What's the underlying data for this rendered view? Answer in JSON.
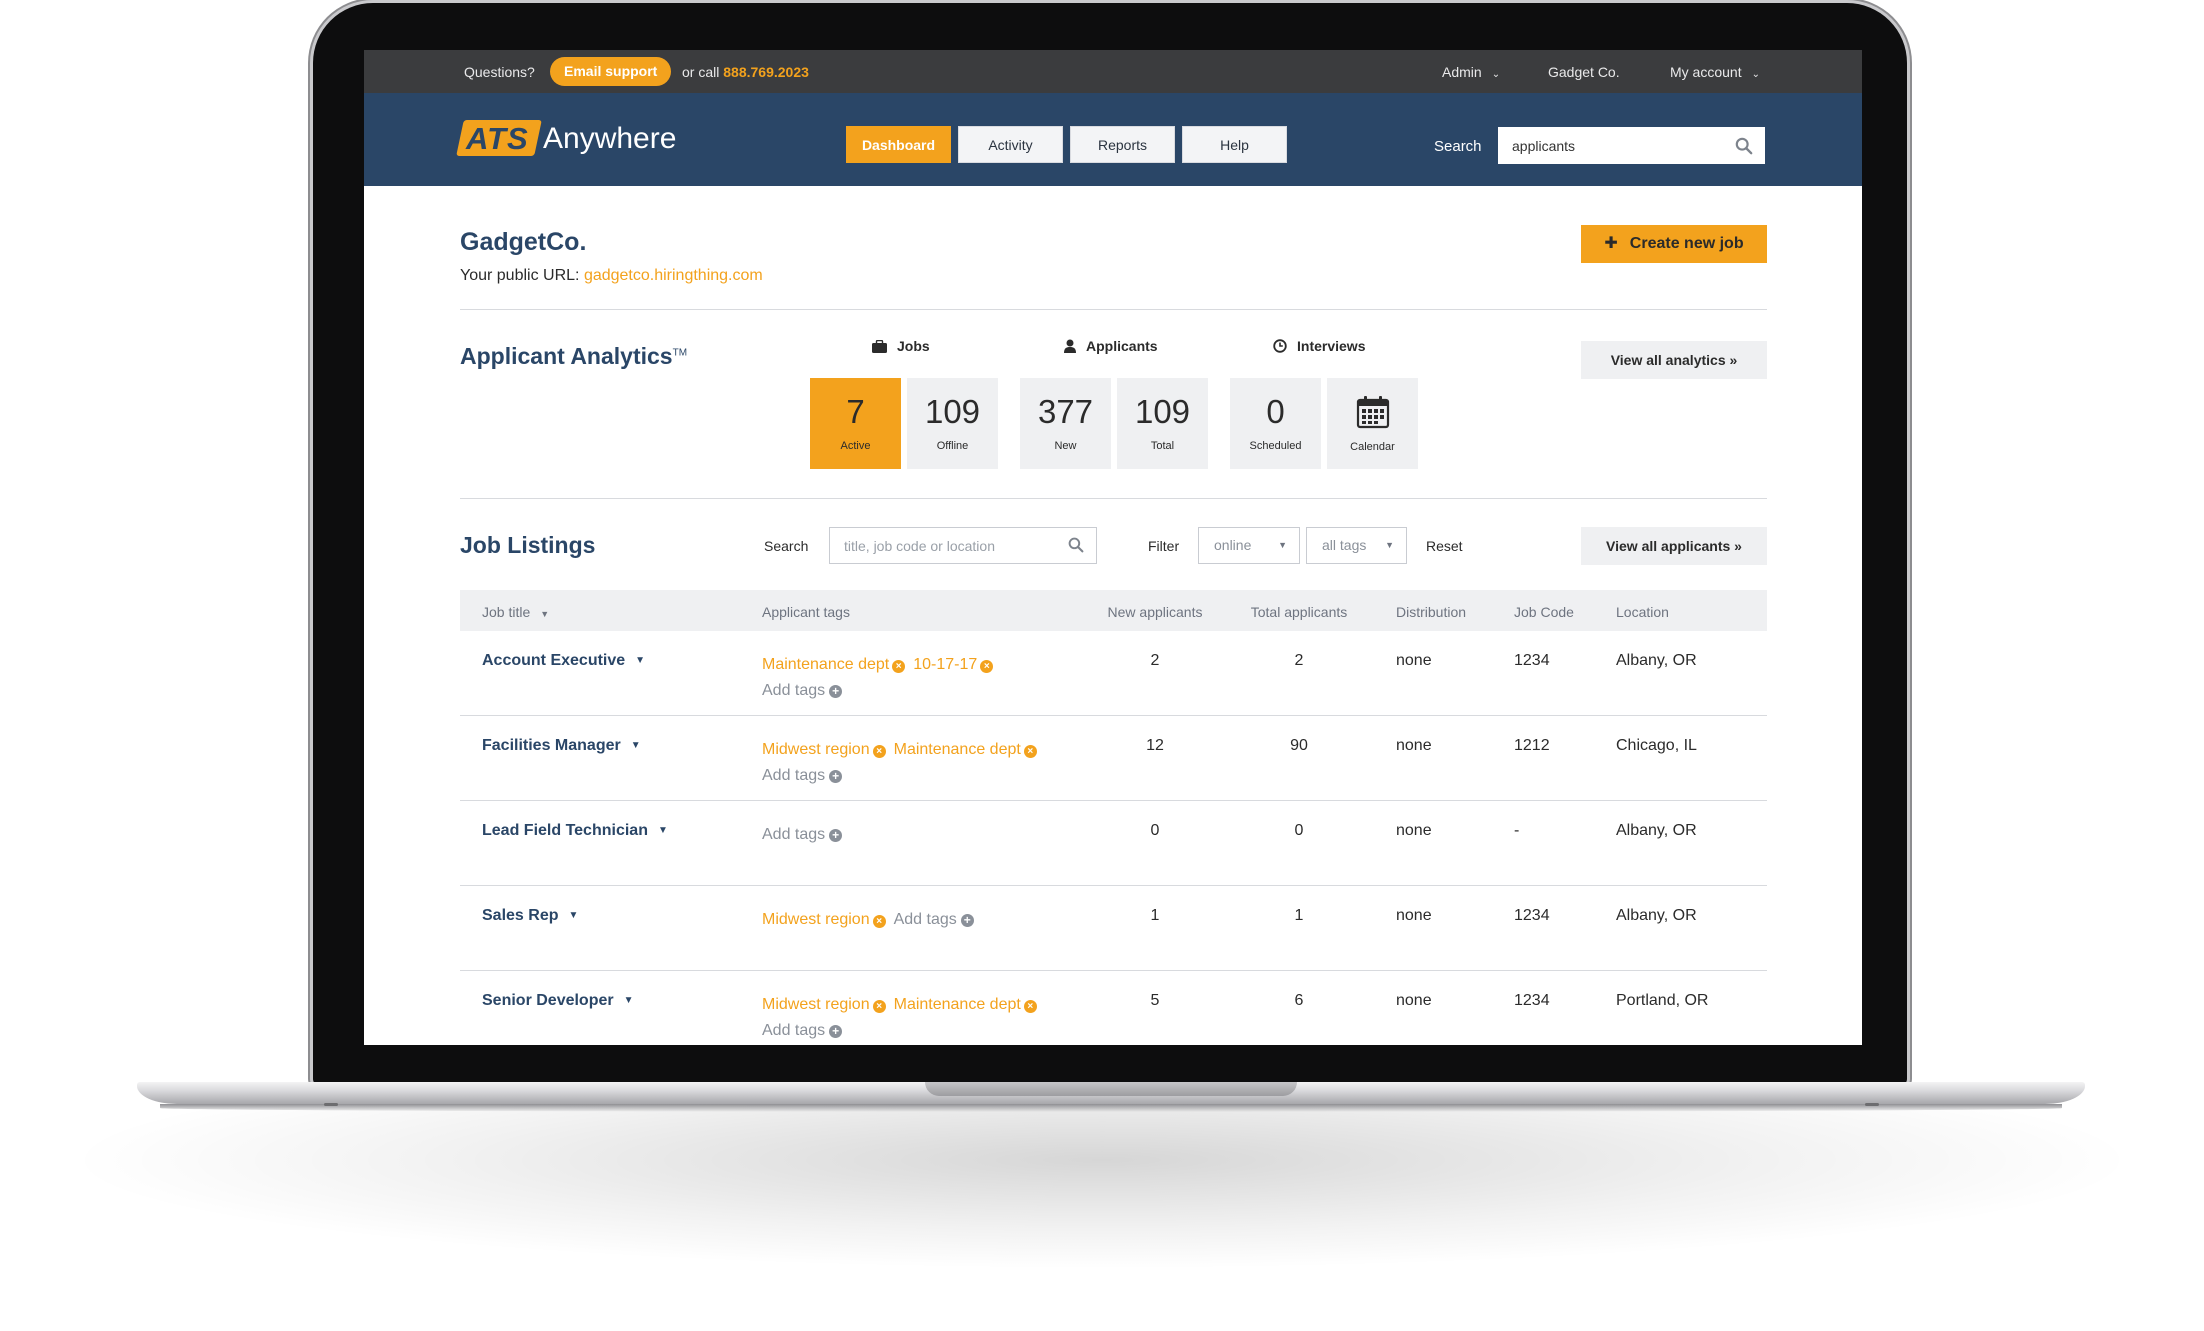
{
  "topbar": {
    "questions": "Questions?",
    "email_support": "Email support",
    "or_call": "or call",
    "phone": "888.769.2023",
    "admin": "Admin",
    "company": "Gadget Co.",
    "my_account": "My account"
  },
  "nav": {
    "logo_ats": "ATS",
    "logo_anywhere": "Anywhere",
    "items": [
      "Dashboard",
      "Activity",
      "Reports",
      "Help"
    ],
    "active": "Dashboard",
    "search_label": "Search",
    "search_value": "applicants"
  },
  "header": {
    "company_name": "GadgetCo.",
    "public_url_label": "Your public URL:",
    "public_url": "gadgetco.hiringthing.com",
    "create_job": "Create new job"
  },
  "analytics": {
    "title": "Applicant Analytics",
    "trademark": "TM",
    "view_all": "View all analytics",
    "groups": {
      "jobs": "Jobs",
      "applicants": "Applicants",
      "interviews": "Interviews"
    },
    "stats": [
      {
        "value": "7",
        "label": "Active"
      },
      {
        "value": "109",
        "label": "Offline"
      },
      {
        "value": "377",
        "label": "New"
      },
      {
        "value": "109",
        "label": "Total"
      },
      {
        "value": "0",
        "label": "Scheduled"
      },
      {
        "value": "",
        "label": "Calendar"
      }
    ]
  },
  "listings": {
    "title": "Job Listings",
    "search_label": "Search",
    "search_placeholder": "title, job code or location",
    "filter_label": "Filter",
    "filter_status": "online",
    "filter_tags": "all tags",
    "reset": "Reset",
    "view_all": "View all applicants",
    "columns": [
      "Job title",
      "Applicant tags",
      "New applicants",
      "Total applicants",
      "Distribution",
      "Job Code",
      "Location"
    ],
    "add_tags": "Add tags",
    "rows": [
      {
        "title": "Account Executive",
        "tags": [
          "Maintenance dept",
          "10-17-17"
        ],
        "new": "2",
        "total": "2",
        "distribution": "none",
        "code": "1234",
        "location": "Albany, OR"
      },
      {
        "title": "Facilities Manager",
        "tags": [
          "Midwest region",
          "Maintenance dept"
        ],
        "new": "12",
        "total": "90",
        "distribution": "none",
        "code": "1212",
        "location": "Chicago, IL"
      },
      {
        "title": "Lead Field Technician",
        "tags": [],
        "new": "0",
        "total": "0",
        "distribution": "none",
        "code": "-",
        "location": "Albany, OR"
      },
      {
        "title": "Sales Rep",
        "tags": [
          "Midwest region"
        ],
        "new": "1",
        "total": "1",
        "distribution": "none",
        "code": "1234",
        "location": "Albany, OR"
      },
      {
        "title": "Senior Developer",
        "tags": [
          "Midwest region",
          "Maintenance dept"
        ],
        "new": "5",
        "total": "6",
        "distribution": "none",
        "code": "1234",
        "location": "Portland, OR"
      }
    ]
  },
  "colors": {
    "accent": "#f3a21d",
    "navy": "#2a4667",
    "topbar": "#3b3c3e"
  }
}
